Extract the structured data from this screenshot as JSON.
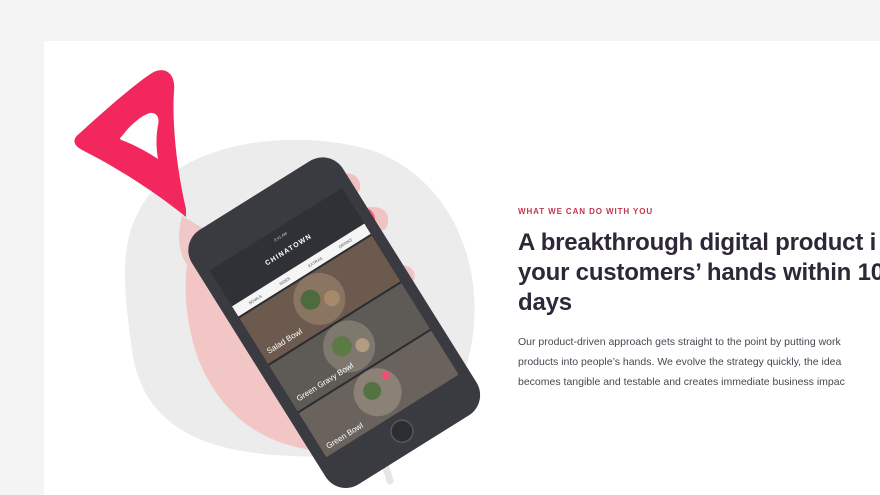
{
  "section": {
    "eyebrow": "WHAT WE CAN DO WITH YOU",
    "headline_lines": [
      "A breakthrough digital product i",
      "your customers’ hands within 10",
      "days"
    ],
    "body_lines": [
      "Our product-driven approach gets straight to the point by putting work",
      "products into people’s hands. We evolve the strategy quickly, the idea",
      "becomes tangible and testable and creates immediate business impac"
    ]
  },
  "phone_app": {
    "app_title": "CHINATOWN",
    "status_time": "9:41 AM",
    "nav_tabs": [
      "BOWLS",
      "SIDES",
      "EXTRAS",
      "DRINKS"
    ],
    "menu_items": [
      "Salad Bowl",
      "Green Gravy Bowl",
      "Green Bowl"
    ]
  },
  "colors": {
    "brand_pink": "#f2275d",
    "eyebrow_red": "#c0394c",
    "headline": "#2e2738",
    "blob": "#ececec"
  }
}
